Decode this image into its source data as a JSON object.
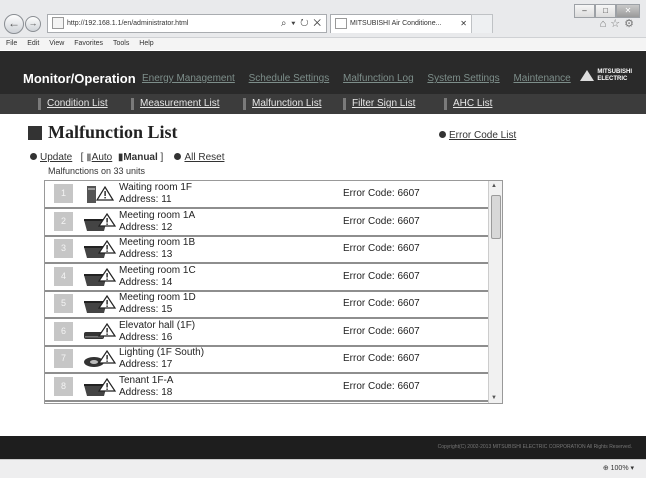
{
  "browser": {
    "url": "http://192.168.1.1/en/administrator.html",
    "url_tools": "⌕ ▾ ↻ ✕",
    "tab_title": "MITSUBISHI Air Conditione...",
    "menu": [
      "File",
      "Edit",
      "View",
      "Favorites",
      "Tools",
      "Help"
    ],
    "zoom": "⊕ 100%  ▾"
  },
  "app": {
    "title": "Monitor/Operation",
    "main_nav": [
      "Energy Management",
      "Schedule Settings",
      "Malfunction Log",
      "System Settings",
      "Maintenance"
    ],
    "logo": [
      "MITSUBISHI",
      "ELECTRIC"
    ],
    "sub_nav": [
      "Condition List",
      "Measurement List",
      "Malfunction List",
      "Filter Sign List",
      "AHC List"
    ]
  },
  "page": {
    "title": "Malfunction List",
    "error_code_list_link": "Error Code List",
    "update_link": "Update",
    "auto_label": "Auto",
    "manual_label": "Manual",
    "all_reset_link": "All Reset",
    "summary": "Malfunctions on 33 units"
  },
  "rows": [
    {
      "num": "1",
      "name": "Waiting room 1F",
      "address": "Address: 11",
      "error": "Error Code: 6607",
      "icon": "tower-unit-warning-icon"
    },
    {
      "num": "2",
      "name": "Meeting room 1A",
      "address": "Address: 12",
      "error": "Error Code: 6607",
      "icon": "cassette-unit-warning-icon"
    },
    {
      "num": "3",
      "name": "Meeting room 1B",
      "address": "Address: 13",
      "error": "Error Code: 6607",
      "icon": "cassette-unit-warning-icon"
    },
    {
      "num": "4",
      "name": "Meeting room 1C",
      "address": "Address: 14",
      "error": "Error Code: 6607",
      "icon": "cassette-unit-warning-icon"
    },
    {
      "num": "5",
      "name": "Meeting room 1D",
      "address": "Address: 15",
      "error": "Error Code: 6607",
      "icon": "cassette-unit-warning-icon"
    },
    {
      "num": "6",
      "name": "Elevator hall (1F)",
      "address": "Address: 16",
      "error": "Error Code: 6607",
      "icon": "wall-unit-warning-icon"
    },
    {
      "num": "7",
      "name": "Lighting (1F South)",
      "address": "Address: 17",
      "error": "Error Code: 6607",
      "icon": "light-warning-icon"
    },
    {
      "num": "8",
      "name": "Tenant 1F-A",
      "address": "Address: 18",
      "error": "Error Code: 6607",
      "icon": "cassette-unit-warning-icon"
    }
  ],
  "footer": {
    "copyright": "Copyright(C) 2002-2013 MITSUBISHI ELECTRIC CORPORATION All Rights Reserved."
  },
  "colors": {
    "header_bg": "#2a2a2a",
    "subnav_bg": "#3c3c3c",
    "nav_link": "#7d8e8a",
    "row_number_bg": "#c6c6c6"
  }
}
